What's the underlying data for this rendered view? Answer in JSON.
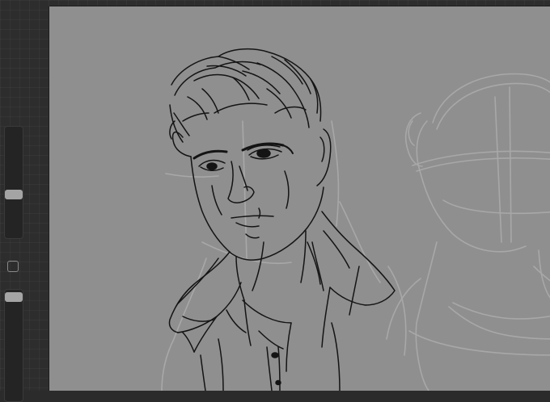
{
  "app": {
    "name": ""
  },
  "sidebar": {
    "brush_size_slider": {
      "level_percent": 38
    },
    "brush_opacity_slider": {
      "level_percent": 2
    },
    "modify_button": {
      "icon": "square-outline-icon"
    }
  },
  "canvas": {
    "background_color": "#8f8f8f",
    "line_color": "#141414",
    "sketch_guide_color": "#a6a6a6",
    "content": "line-art sketch"
  }
}
